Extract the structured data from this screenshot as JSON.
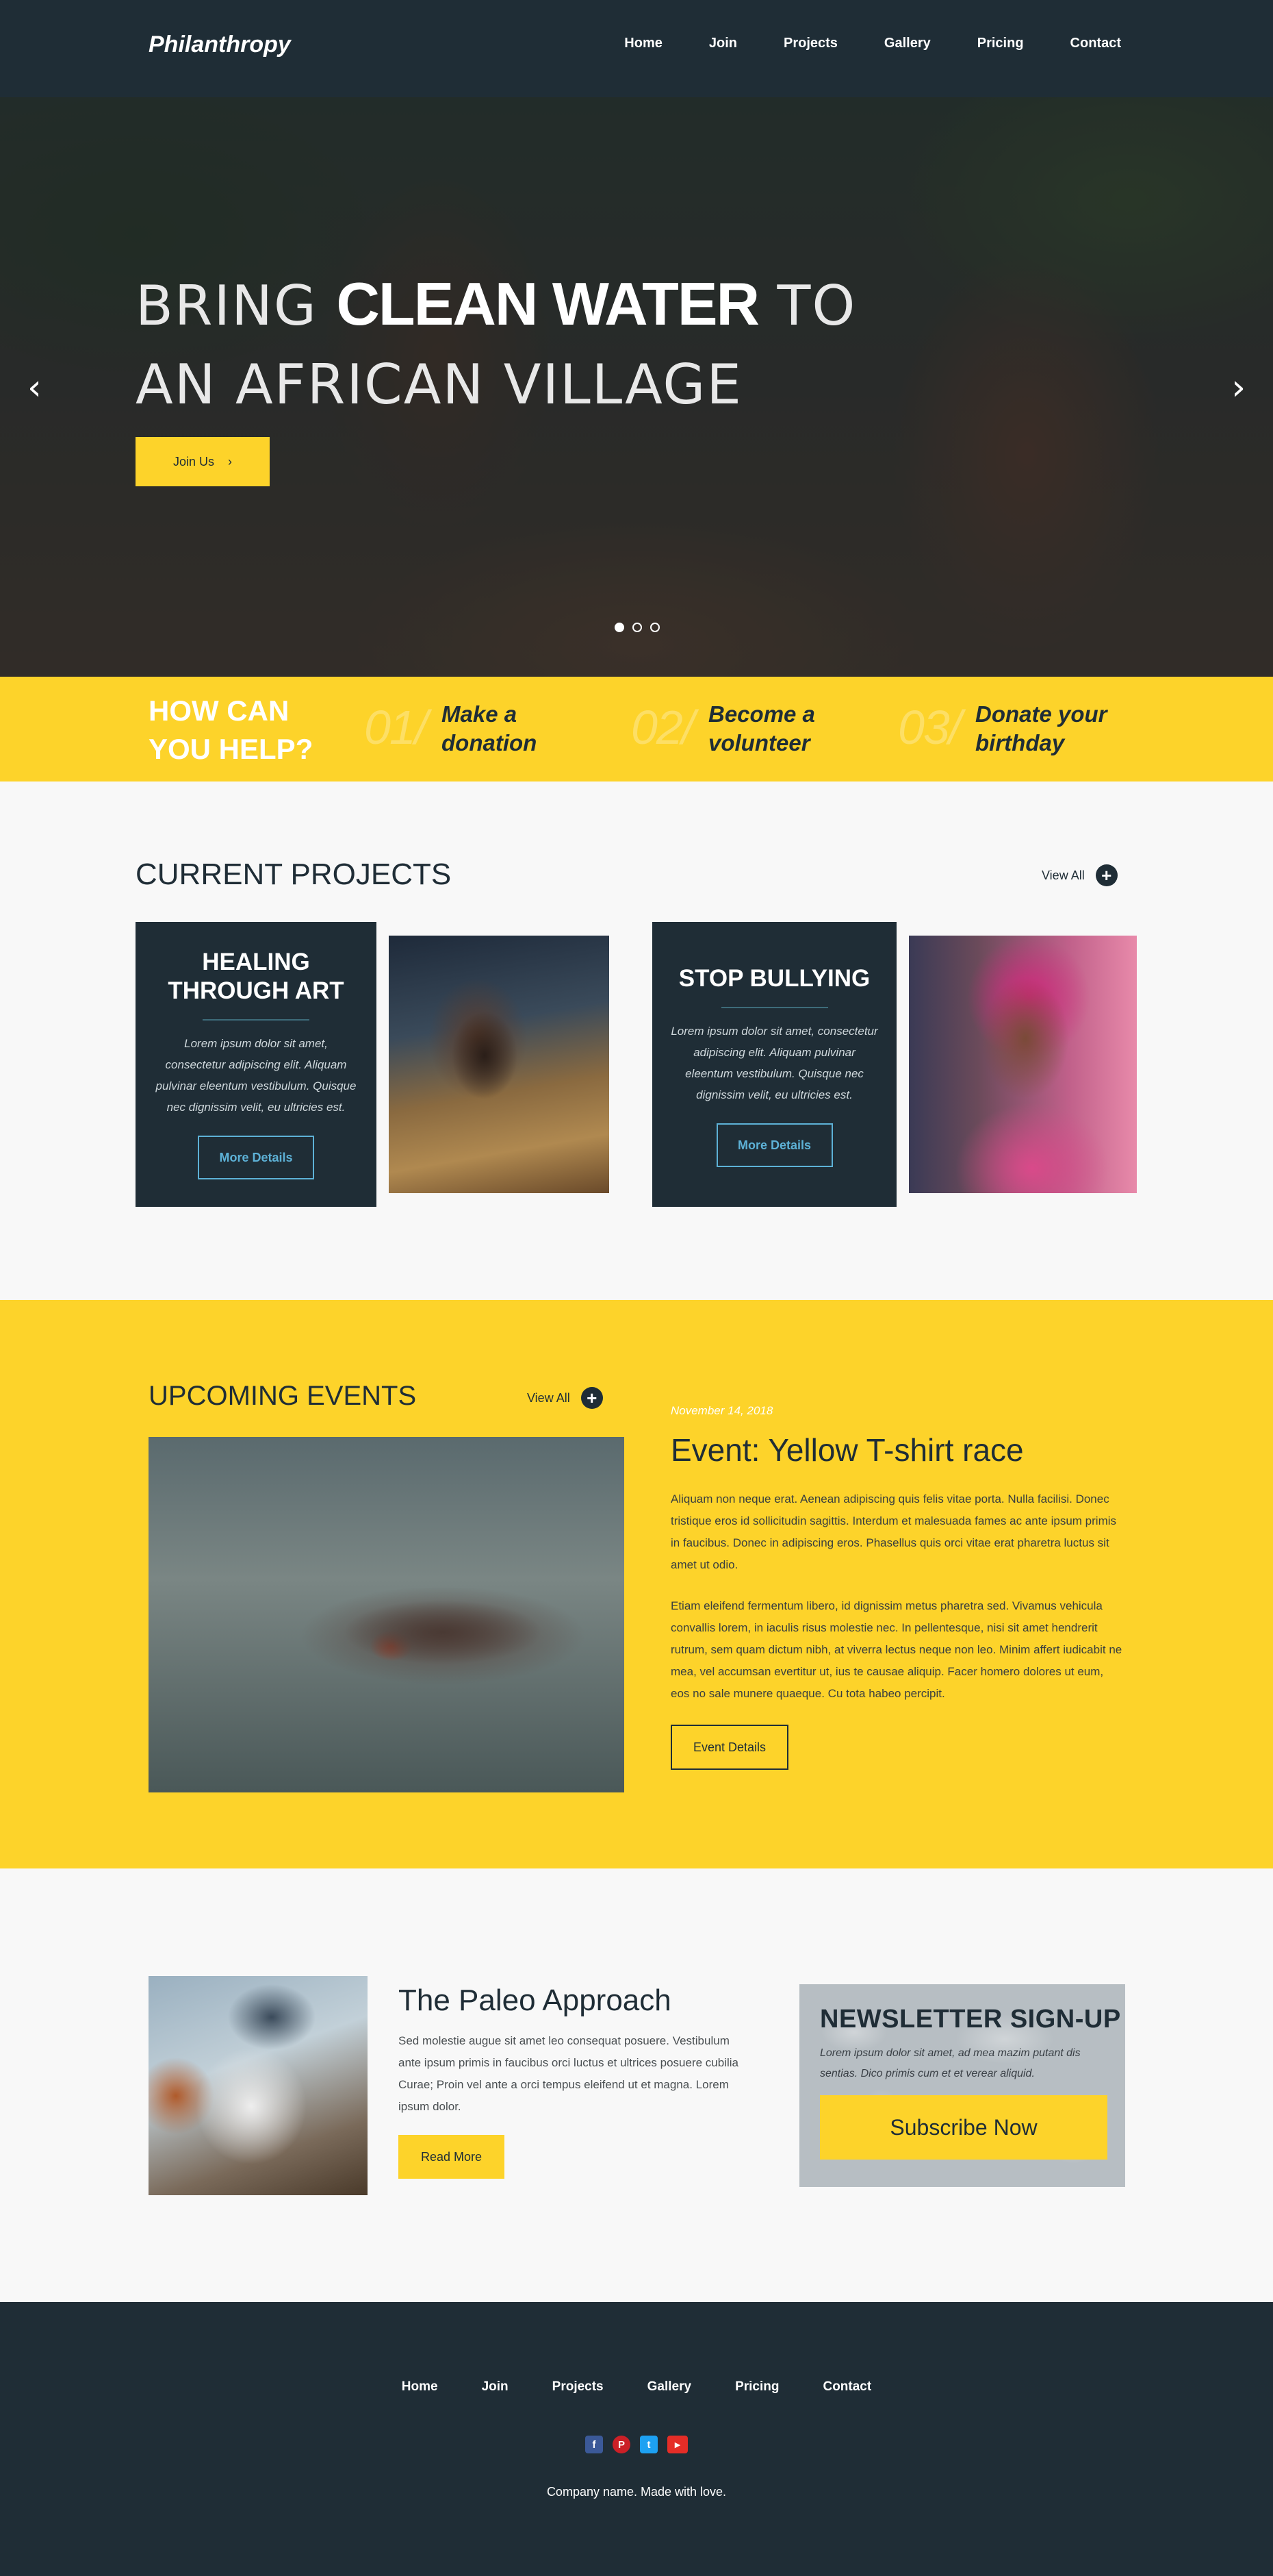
{
  "nav": {
    "brand": "Philanthropy",
    "links": [
      "Home",
      "Join",
      "Projects",
      "Gallery",
      "Pricing",
      "Contact"
    ]
  },
  "hero": {
    "line1_a": "BRING ",
    "line1_b": "CLEAN WATER",
    "line1_c": " TO",
    "line2": "AN AFRICAN VILLAGE",
    "button_label": "Join Us",
    "button_icon": "chevron-right-icon",
    "prev_icon": "chevron-left-icon",
    "next_icon": "chevron-right-icon",
    "slides_total": 3,
    "slide_active": 1
  },
  "help": {
    "title_line1": "HOW CAN",
    "title_line2": "YOU HELP?",
    "items": [
      {
        "num": "01/",
        "text": "Make a donation"
      },
      {
        "num": "02/",
        "text": "Become a volunteer"
      },
      {
        "num": "03/",
        "text": "Donate your birthday"
      }
    ]
  },
  "projects": {
    "title": "CURRENT PROJECTS",
    "view_all": "View All",
    "cards": [
      {
        "title": "HEALING THROUGH ART",
        "body": "Lorem ipsum dolor sit amet, consectetur adipiscing elit. Aliquam pulvinar eleentum vestibulum. Quisque nec dignissim velit, eu ultricies est.",
        "button": "More Details"
      },
      {
        "title": "STOP BULLYING",
        "body": "Lorem ipsum dolor sit amet, consectetur adipiscing elit. Aliquam pulvinar eleentum vestibulum. Quisque nec dignissim velit, eu ultricies est.",
        "button": "More Details"
      }
    ]
  },
  "events": {
    "title": "UPCOMING EVENTS",
    "view_all": "View All",
    "date": "November 14, 2018",
    "event_title": "Event: Yellow T-shirt race",
    "p1": "Aliquam non neque erat. Aenean adipiscing quis felis vitae porta. Nulla facilisi. Donec tristique eros id sollicitudin sagittis. Interdum et malesuada fames ac ante ipsum primis in faucibus. Donec in adipiscing eros. Phasellus quis orci vitae erat pharetra luctus sit amet ut odio.",
    "p2": "Etiam eleifend fermentum libero, id dignissim metus pharetra sed. Vivamus vehicula convallis lorem, in iaculis risus molestie nec. In pellentesque, nisi sit amet hendrerit rutrum, sem quam dictum nibh, at viverra lectus neque non leo. Minim affert iudicabit ne mea, vel accumsan evertitur ut, ius te causae aliquip. Facer homero dolores ut eum, eos no sale munere quaeque. Cu tota habeo percipit.",
    "button": "Event Details"
  },
  "paleo": {
    "title": "The Paleo Approach",
    "body": "Sed molestie augue sit amet leo consequat posuere. Vestibulum ante ipsum primis in faucibus orci luctus et ultrices posuere cubilia Curae; Proin vel ante a orci tempus eleifend ut et magna. Lorem ipsum dolor.",
    "button": "Read More"
  },
  "newsletter": {
    "title": "NEWSLETTER SIGN-UP",
    "body": "Lorem ipsum dolor sit amet, ad mea mazim putant dis sentias. Dico primis cum et et verear aliquid.",
    "button": "Subscribe Now"
  },
  "footer": {
    "links": [
      "Home",
      "Join",
      "Projects",
      "Gallery",
      "Pricing",
      "Contact"
    ],
    "social": [
      {
        "icon": "facebook-icon",
        "glyph": "f",
        "color": "#3b5998"
      },
      {
        "icon": "pinterest-icon",
        "glyph": "P",
        "color": "#cb2027"
      },
      {
        "icon": "twitter-icon",
        "glyph": "t",
        "color": "#1da1f2"
      },
      {
        "icon": "youtube-icon",
        "glyph": "▶",
        "color": "#e52d27"
      }
    ],
    "copyright": "Company name. Made with love."
  },
  "colors": {
    "navy": "#1f2d36",
    "yellow": "#fdd32a",
    "link_blue": "#5db1d6"
  }
}
